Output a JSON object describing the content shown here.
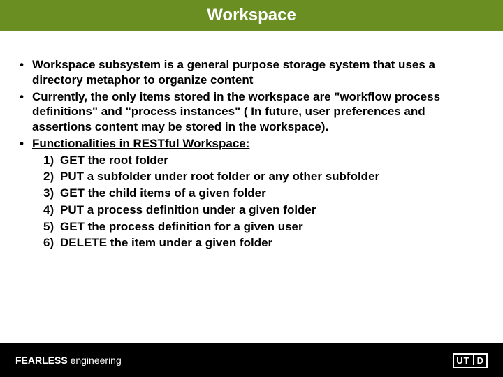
{
  "title": "Workspace",
  "bullets": [
    "Workspace subsystem is a general purpose storage system that uses a directory metaphor to organize content",
    "Currently, the only items stored in the workspace are \"workflow process definitions\" and \"process instances\" ( In future, user preferences and assertions content may be stored in the workspace)."
  ],
  "func_heading": "Functionalities in RESTful Workspace:",
  "functions": [
    "GET the root folder",
    "PUT  a subfolder under root folder or any other subfolder",
    "GET the child items of a given folder",
    "PUT  a process definition under a given folder",
    "GET the process definition for a given user",
    "DELETE the item under a given folder"
  ],
  "footer": {
    "bold": "FEARLESS",
    "rest": " engineering"
  },
  "logo": {
    "left": "UT",
    "right": "D"
  }
}
